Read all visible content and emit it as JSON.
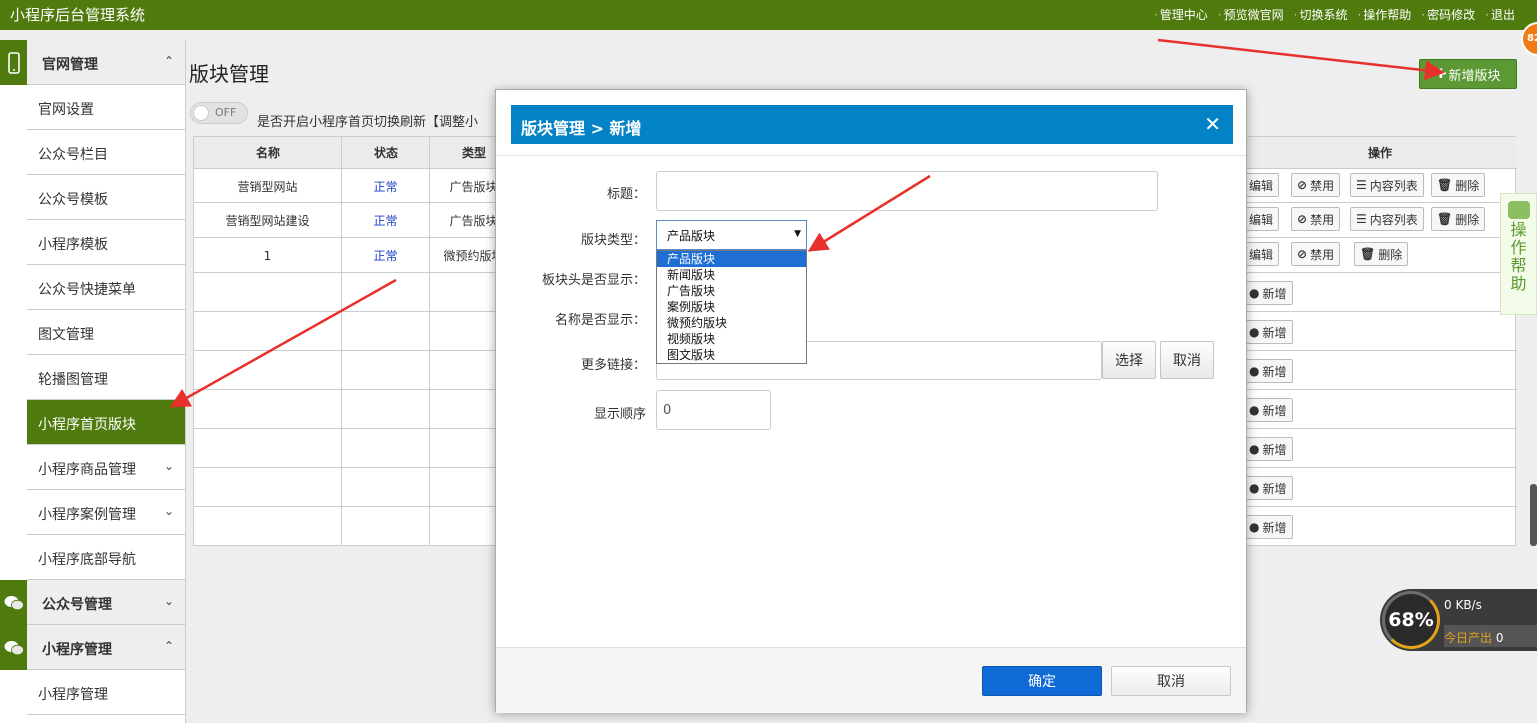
{
  "app": {
    "title": "小程序后台管理系统",
    "top_nav": [
      "管理中心",
      "预览微官网",
      "切换系统",
      "操作帮助",
      "密码修改",
      "退出"
    ],
    "corner_badge": "82"
  },
  "sidebar": {
    "sections": [
      {
        "label": "官网管理",
        "icon": "mobile-icon",
        "expanded": true,
        "items": [
          {
            "label": "官网设置"
          },
          {
            "label": "公众号栏目"
          },
          {
            "label": "公众号模板"
          },
          {
            "label": "小程序模板"
          },
          {
            "label": "公众号快捷菜单"
          },
          {
            "label": "图文管理"
          },
          {
            "label": "轮播图管理"
          },
          {
            "label": "小程序首页版块",
            "active": true
          },
          {
            "label": "小程序商品管理",
            "has_children": true
          },
          {
            "label": "小程序案例管理",
            "has_children": true
          },
          {
            "label": "小程序底部导航"
          }
        ]
      },
      {
        "label": "公众号管理",
        "icon": "wechat-icon",
        "expanded": false
      },
      {
        "label": "小程序管理",
        "icon": "wechat-icon",
        "expanded": true,
        "items": [
          {
            "label": "小程序管理"
          }
        ]
      }
    ],
    "colors": {
      "accent": "#4f7a0d"
    }
  },
  "main": {
    "title": "版块管理",
    "add_button": "新增版块",
    "toggle": {
      "state": "OFF",
      "label": "是否开启小程序首页切换刷新【调整小"
    },
    "table": {
      "columns": [
        "名称",
        "状态",
        "类型",
        "操作"
      ],
      "rows": [
        {
          "name": "营销型网站",
          "status": "正常",
          "type": "广告版块",
          "ops": [
            "编辑",
            "禁用",
            "内容列表",
            "删除"
          ]
        },
        {
          "name": "营销型网站建设",
          "status": "正常",
          "type": "广告版块",
          "ops": [
            "编辑",
            "禁用",
            "内容列表",
            "删除"
          ]
        },
        {
          "name": "1",
          "status": "正常",
          "type": "微预约版块",
          "ops": [
            "编辑",
            "禁用",
            "删除"
          ]
        }
      ],
      "empty_row_action": "新增"
    }
  },
  "modal": {
    "breadcrumb": "版块管理 > 新增",
    "fields": {
      "title_label": "标题：",
      "title_value": "",
      "type_label": "版块类型：",
      "type_selected": "产品版块",
      "type_options": [
        "产品版块",
        "新闻版块",
        "广告版块",
        "案例版块",
        "微预约版块",
        "视频版块",
        "图文版块"
      ],
      "header_show_label": "板块头是否显示：",
      "name_show_label": "名称是否显示：",
      "more_link_label": "更多链接：",
      "more_link_value": "",
      "select_button": "选择",
      "cancel_link_button": "取消",
      "order_label": "显示顺序",
      "order_value": "0"
    },
    "confirm_button": "确定",
    "cancel_button": "取消",
    "header_color": "#0383c6"
  },
  "help_widget": {
    "label": "操作帮助"
  },
  "speed_widget": {
    "percent": "68%",
    "rate": "0 KB/s",
    "today_label": "今日产出",
    "today_value": "0"
  }
}
